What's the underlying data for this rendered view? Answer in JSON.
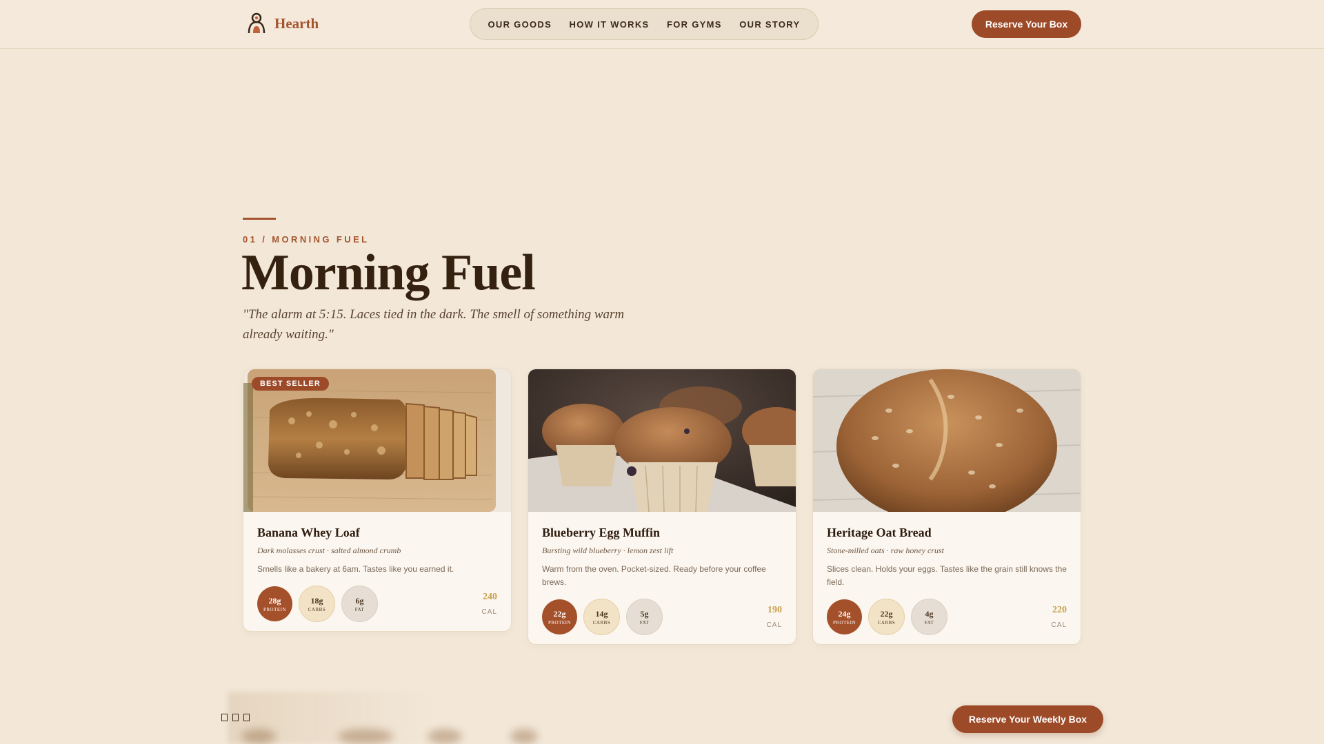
{
  "brand": {
    "name": "Hearth",
    "icon": "hearth-logo-icon"
  },
  "nav": {
    "items": [
      "OUR GOODS",
      "HOW IT WORKS",
      "FOR GYMS",
      "OUR STORY"
    ]
  },
  "header_cta": "Reserve Your Box",
  "section": {
    "eyebrow": "01 / MORNING FUEL",
    "title": "Morning Fuel",
    "quote": "\"The alarm at 5:15. Laces tied in the dark. The smell of something warm already waiting.\""
  },
  "products": [
    {
      "badge": "BEST SELLER",
      "name": "Banana Whey Loaf",
      "subtitle": "Dark molasses crust · salted almond crumb",
      "description": "Smells like a bakery at 6am. Tastes like you earned it.",
      "protein": "28g",
      "carbs": "18g",
      "fat": "6g",
      "calories": "240",
      "image": "banana-loaf-photo"
    },
    {
      "name": "Blueberry Egg Muffin",
      "subtitle": "Bursting wild blueberry · lemon zest lift",
      "description": "Warm from the oven. Pocket-sized. Ready before your coffee brews.",
      "protein": "22g",
      "carbs": "14g",
      "fat": "5g",
      "calories": "190",
      "image": "blueberry-muffin-photo"
    },
    {
      "name": "Heritage Oat Bread",
      "subtitle": "Stone-milled oats · raw honey crust",
      "description": "Slices clean. Holds your eggs. Tastes like the grain still knows the field.",
      "protein": "24g",
      "carbs": "22g",
      "fat": "4g",
      "calories": "220",
      "image": "oat-bread-photo"
    }
  ],
  "macro_labels": {
    "protein": "PROTEIN",
    "carbs": "CARBS",
    "fat": "FAT",
    "calories": "CAL"
  },
  "footer_cta": "Reserve Your Weekly Box",
  "colors": {
    "accent": "#9c4a28",
    "background": "#f3e8d8",
    "calories": "#c9a04e"
  }
}
